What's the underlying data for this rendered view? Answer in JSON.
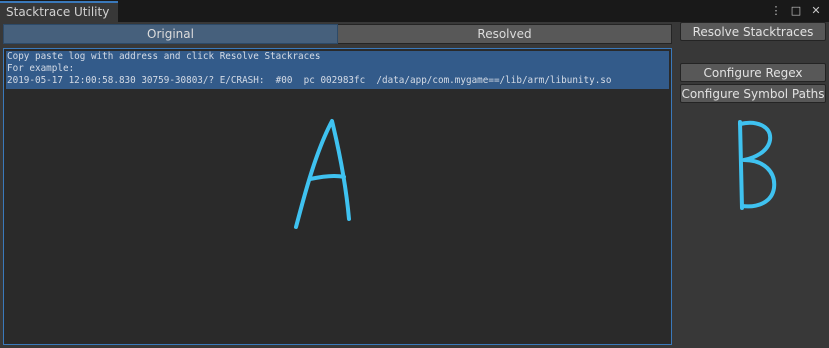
{
  "window": {
    "tab_title": "Stacktrace Utility",
    "controls": {
      "menu": "⋮",
      "maximize": "□",
      "close": "✕"
    }
  },
  "tabs": [
    {
      "label": "Original",
      "active": true
    },
    {
      "label": "Resolved",
      "active": false
    }
  ],
  "log": {
    "lines": [
      "Copy paste log with address and click Resolve Stackraces",
      "For example:",
      "2019-05-17 12:00:58.830 30759-30803/? E/CRASH:  #00  pc 002983fc  /data/app/com.mygame==/lib/arm/libunity.so"
    ]
  },
  "sidebar": {
    "resolve_label": "Resolve Stacktraces",
    "configure_regex_label": "Configure Regex",
    "configure_symbol_paths_label": "Configure Symbol Paths"
  },
  "annotations": {
    "a": "A",
    "b": "B",
    "color": "#3fc2f0"
  },
  "colors": {
    "accent": "#3a79bb",
    "selection": "#335b8a",
    "background": "#383838"
  }
}
